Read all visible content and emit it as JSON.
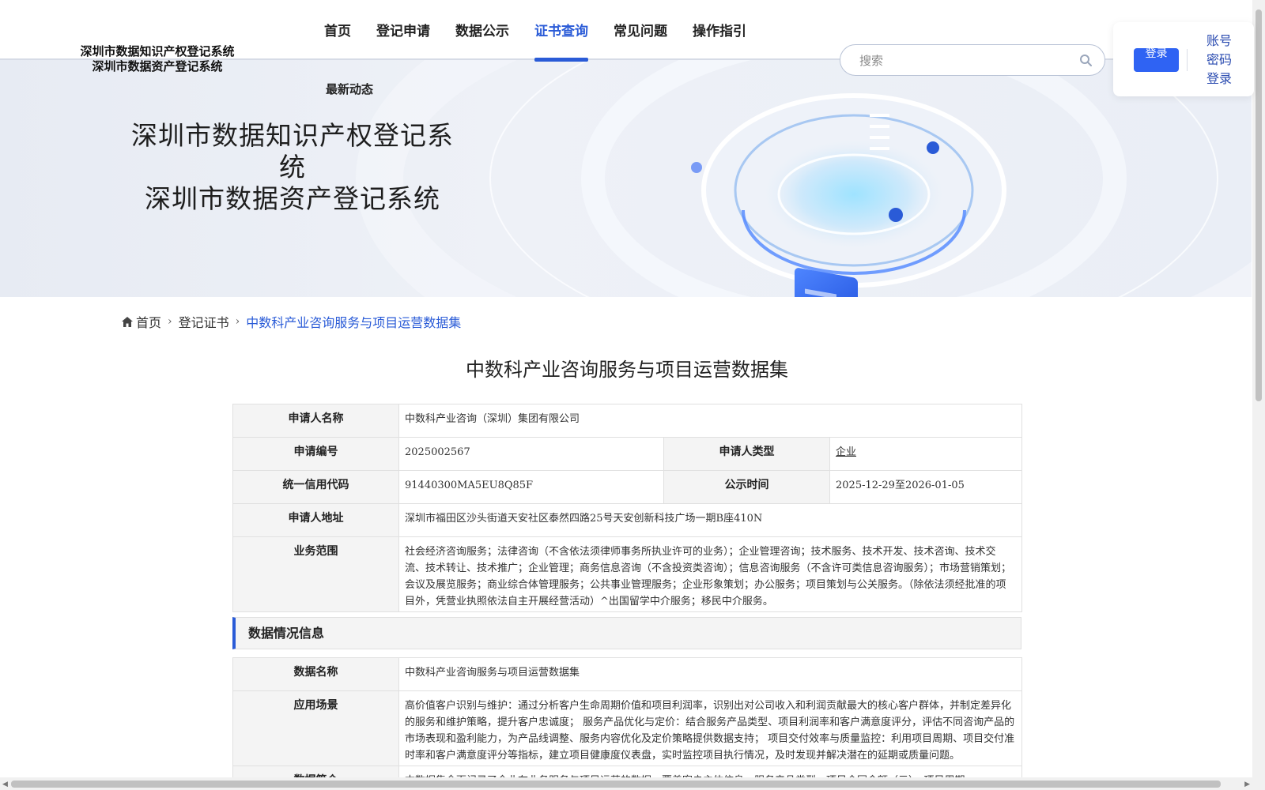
{
  "header": {
    "logo_line1": "深圳市数据知识产权登记系统",
    "logo_line2": "深圳市数据资产登记系统",
    "nav": [
      "首页",
      "登记申请",
      "数据公示",
      "证书查询",
      "常见问题",
      "操作指引"
    ],
    "nav_active_index": 3,
    "nav_sub": "最新动态",
    "search_placeholder": "搜索",
    "login_button": "登录",
    "login_alt": [
      "账号",
      "密码",
      "登录"
    ]
  },
  "banner": {
    "title_line1": "深圳市数据知识产权登记系统",
    "title_line2": "深圳市数据资产登记系统"
  },
  "breadcrumb": {
    "home": "首页",
    "level2": "登记证书",
    "current": "中数科产业咨询服务与项目运营数据集"
  },
  "page_title": "中数科产业咨询服务与项目运营数据集",
  "applicant": {
    "name_label": "申请人名称",
    "name_value": "中数科产业咨询（深圳）集团有限公司",
    "no_label": "申请编号",
    "no_value": "2025002567",
    "type_label": "申请人类型",
    "type_value": "企业",
    "credit_label": "统一信用代码",
    "credit_value": "91440300MA5EU8Q85F",
    "pub_label": "公示时间",
    "pub_value": "2025-12-29至2026-01-05",
    "addr_label": "申请人地址",
    "addr_value": "深圳市福田区沙头街道天安社区泰然四路25号天安创新科技广场一期B座410N",
    "scope_label": "业务范围",
    "scope_value": "社会经济咨询服务；法律咨询（不含依法须律师事务所执业许可的业务）；企业管理咨询；技术服务、技术开发、技术咨询、技术交流、技术转让、技术推广；企业管理；商务信息咨询（不含投资类咨询）；信息咨询服务（不含许可类信息咨询服务）；市场营销策划；会议及展览服务；商业综合体管理服务；公共事业管理服务；企业形象策划；办公服务；项目策划与公关服务。（除依法须经批准的项目外，凭营业执照依法自主开展经营活动）^出国留学中介服务；移民中介服务。"
  },
  "data_section": {
    "heading": "数据情况信息",
    "name_label": "数据名称",
    "name_value": "中数科产业咨询服务与项目运营数据集",
    "scene_label": "应用场景",
    "scene_value": "高价值客户识别与维护：通过分析客户生命周期价值和项目利润率，识别出对公司收入和利润贡献最大的核心客户群体，并制定差异化的服务和维护策略，提升客户忠诚度； 服务产品优化与定价：结合服务产品类型、项目利润率和客户满意度评分，评估不同咨询产品的市场表现和盈利能力，为产品线调整、服务内容优化及定价策略提供数据支持； 项目交付效率与质量监控：利用项目周期、项目交付准时率和客户满意度评分等指标，建立项目健康度仪表盘，实时监控项目执行情况，及时发现并解决潜在的延期或质量问题。",
    "next_label": "数据简介",
    "next_value": "本数据集全面记录了企业在业务服务与项目运营的数据，覆盖客户主体信息、服务产品类型、项目合同金额（元）、项目周期"
  },
  "colors": {
    "accent": "#2a5bd7",
    "login_button": "#2f63f3",
    "label_bg": "#f4f4f4"
  }
}
